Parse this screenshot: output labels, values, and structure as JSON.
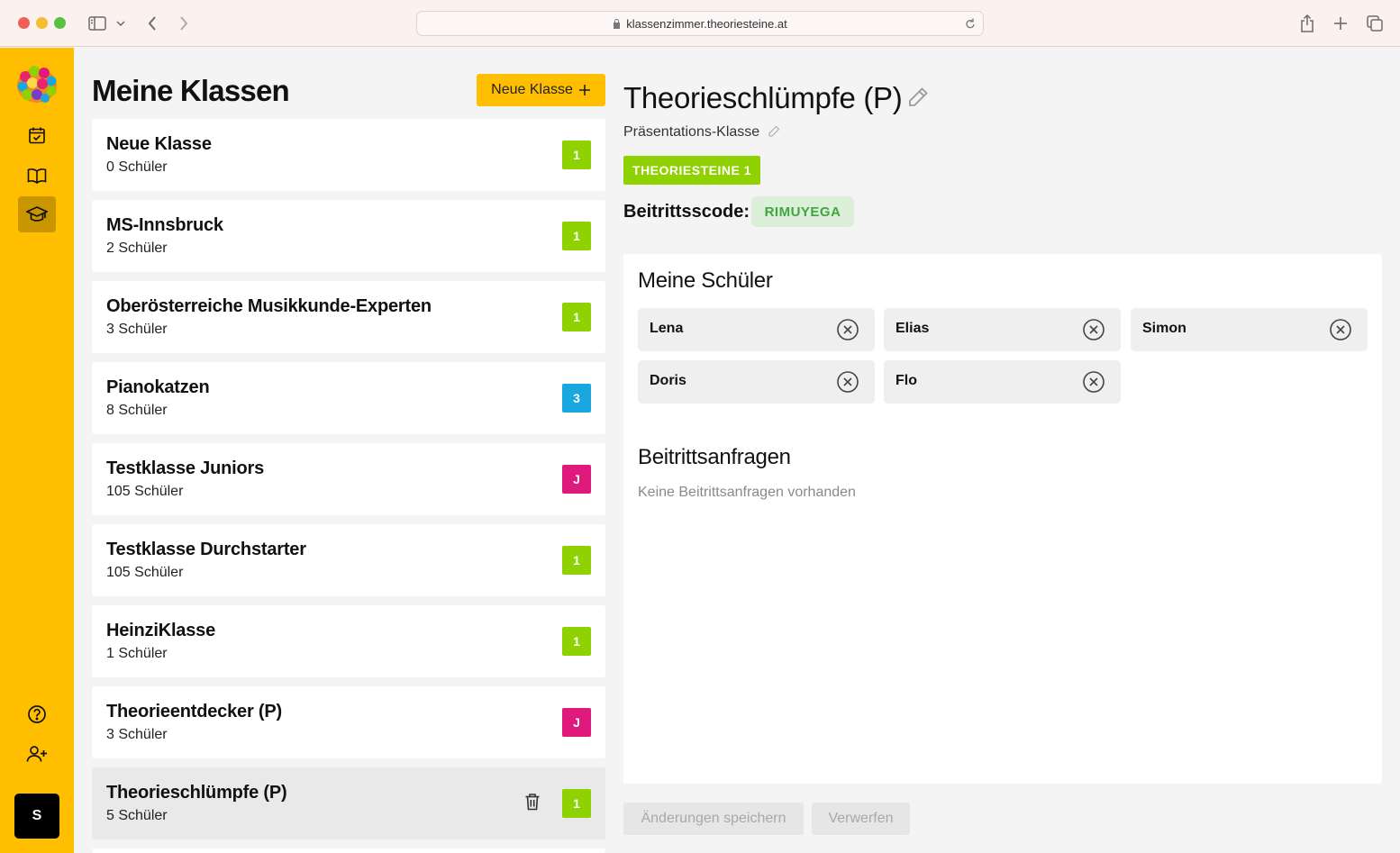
{
  "browser": {
    "url": "klassenzimmer.theoriesteine.at"
  },
  "sidebar": {
    "avatar_initial": "S"
  },
  "list": {
    "title": "Meine Klassen",
    "new_button": "Neue Klasse",
    "classes": [
      {
        "name": "Neue Klasse",
        "count": "0 Schüler",
        "badge": "1",
        "badge_color": "#8fd101"
      },
      {
        "name": "MS-Innsbruck",
        "count": "2 Schüler",
        "badge": "1",
        "badge_color": "#8fd101"
      },
      {
        "name": "Oberösterreiche Musikkunde-Experten",
        "count": "3 Schüler",
        "badge": "1",
        "badge_color": "#8fd101"
      },
      {
        "name": "Pianokatzen",
        "count": "8 Schüler",
        "badge": "3",
        "badge_color": "#1aa6df"
      },
      {
        "name": "Testklasse Juniors",
        "count": "105 Schüler",
        "badge": "J",
        "badge_color": "#e0197d"
      },
      {
        "name": "Testklasse Durchstarter",
        "count": "105 Schüler",
        "badge": "1",
        "badge_color": "#8fd101"
      },
      {
        "name": "HeinziKlasse",
        "count": "1 Schüler",
        "badge": "1",
        "badge_color": "#8fd101"
      },
      {
        "name": "Theorieentdecker (P)",
        "count": "3 Schüler",
        "badge": "J",
        "badge_color": "#e0197d"
      },
      {
        "name": "Theorieschlümpfe (P)",
        "count": "5 Schüler",
        "badge": "1",
        "badge_color": "#8fd101"
      }
    ]
  },
  "detail": {
    "title": "Theorieschlümpfe (P)",
    "subtitle": "Präsentations-Klasse",
    "pack_badge": "THEORIESTEINE 1",
    "code_label": "Beitrittsscode:",
    "code_value": "RIMUYEGA",
    "students_heading": "Meine Schüler",
    "students": [
      "Lena",
      "Elias",
      "Simon",
      "Doris",
      "Flo"
    ],
    "requests_heading": "Beitrittsanfragen",
    "requests_empty": "Keine Beitrittsanfragen vorhanden",
    "save_button": "Änderungen speichern",
    "discard_button": "Verwerfen"
  },
  "colors": {
    "accent": "#ffbf00",
    "accent_dark": "#c99600",
    "green": "#8fd101",
    "blue": "#1aa6df",
    "magenta": "#e0197d"
  }
}
